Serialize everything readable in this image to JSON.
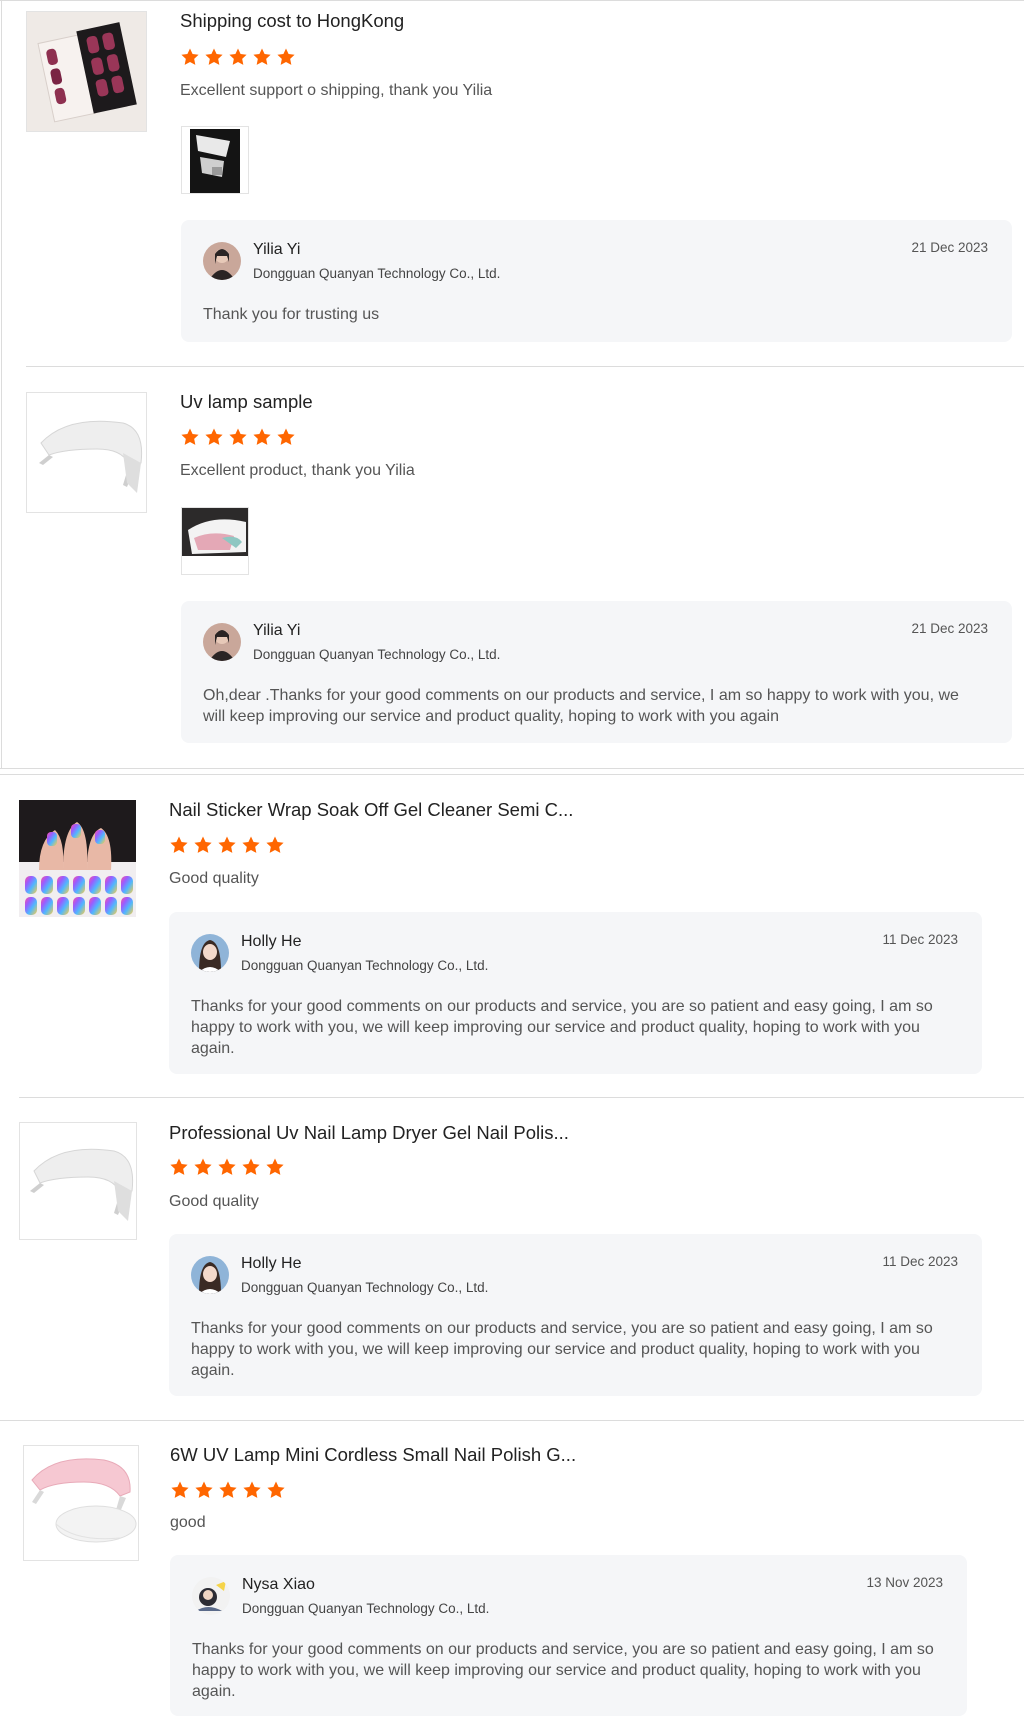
{
  "colors": {
    "star": "#ff6600",
    "reply_bg": "#f5f6f8",
    "divider": "#dcdcdc"
  },
  "reviews": [
    {
      "product": "Shipping cost to HongKong",
      "rating": 5,
      "comment": "Excellent support o shipping,  thank you Yilia",
      "has_photo": true,
      "reply": {
        "name": "Yilia Yi",
        "company": "Dongguan Quanyan Technology Co., Ltd.",
        "date": "21 Dec 2023",
        "text": "Thank you for trusting us"
      }
    },
    {
      "product": "Uv lamp sample",
      "rating": 5,
      "comment": "Excellent product,  thank you Yilia",
      "has_photo": true,
      "reply": {
        "name": "Yilia Yi",
        "company": "Dongguan Quanyan Technology Co., Ltd.",
        "date": "21 Dec 2023",
        "text_line1": "Oh,dear .Thanks for your good comments on our products and service, I am so happy to work with you, we",
        "text_line2": "will keep improving our service and product quality, hoping to  work with you again"
      }
    },
    {
      "product": "Nail Sticker Wrap Soak Off Gel Cleaner Semi C...",
      "rating": 5,
      "comment": "Good quality",
      "reply": {
        "name": "Holly He",
        "company": "Dongguan Quanyan Technology Co., Ltd.",
        "date": "11 Dec 2023",
        "text_line1": "Thanks for your good comments on our products and service, you are so patient and easy going, I am so",
        "text_line2": "happy to work with you, we will keep improving our service and product quality, hoping to  work with you",
        "text_line3": "again."
      }
    },
    {
      "product": "Professional Uv Nail Lamp Dryer Gel Nail Polis...",
      "rating": 5,
      "comment": "Good quality",
      "reply": {
        "name": "Holly He",
        "company": "Dongguan Quanyan Technology Co., Ltd.",
        "date": "11 Dec 2023",
        "text_line1": "Thanks for your good comments on our products and service, you are so patient and easy going, I am so",
        "text_line2": "happy to work with you, we will keep improving our service and product quality, hoping to  work with you",
        "text_line3": "again."
      }
    },
    {
      "product": "6W UV Lamp Mini Cordless Small Nail Polish G...",
      "rating": 5,
      "comment": "good",
      "reply": {
        "name": "Nysa Xiao",
        "company": "Dongguan Quanyan Technology Co., Ltd.",
        "date": "13 Nov 2023",
        "text_line1": "Thanks for your good comments on our products and service, you are so patient and easy going, I am so",
        "text_line2": "happy to work with you, we will keep improving our service and product quality, hoping to  work with you",
        "text_line3": "again."
      }
    }
  ]
}
